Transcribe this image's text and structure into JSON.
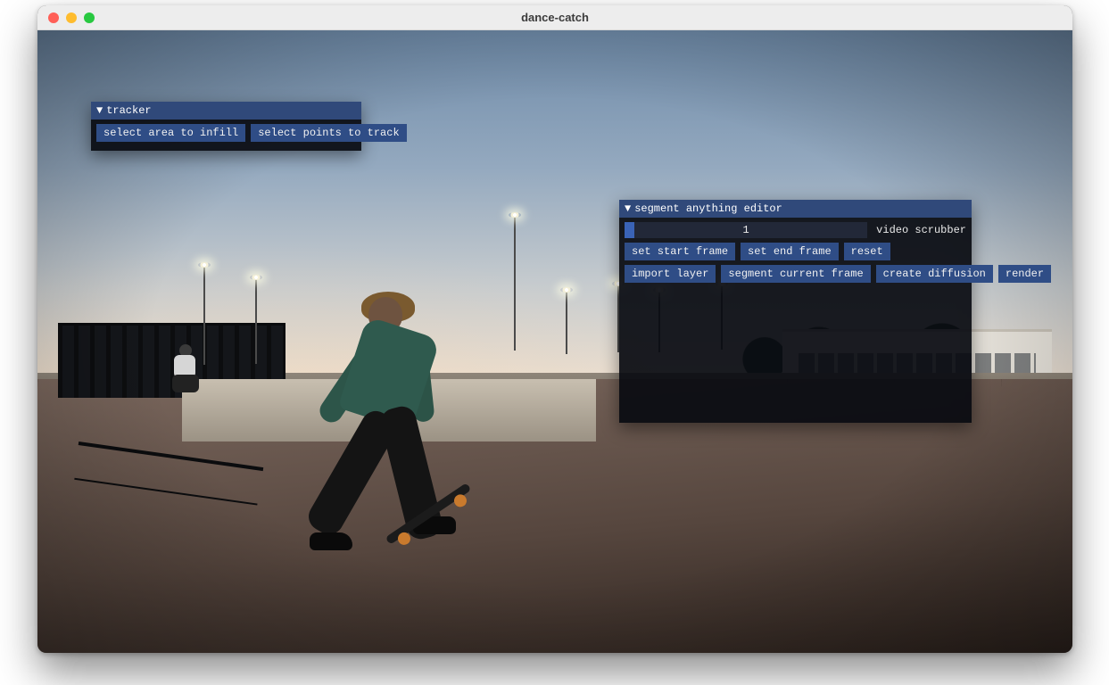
{
  "window": {
    "title": "dance-catch"
  },
  "tracker_panel": {
    "title": "tracker",
    "caret": "▼",
    "buttons": {
      "select_area": "select area to infill",
      "select_points": "select points to track"
    }
  },
  "editor_panel": {
    "title": "segment anything editor",
    "caret": "▼",
    "scrubber": {
      "value": "1",
      "label": "video scrubber"
    },
    "row1": {
      "set_start": "set start frame",
      "set_end": "set end frame",
      "reset": "reset"
    },
    "row2": {
      "import_layer": "import layer",
      "segment_current": "segment current frame",
      "create_diffusion": "create diffusion",
      "render": "render"
    }
  }
}
